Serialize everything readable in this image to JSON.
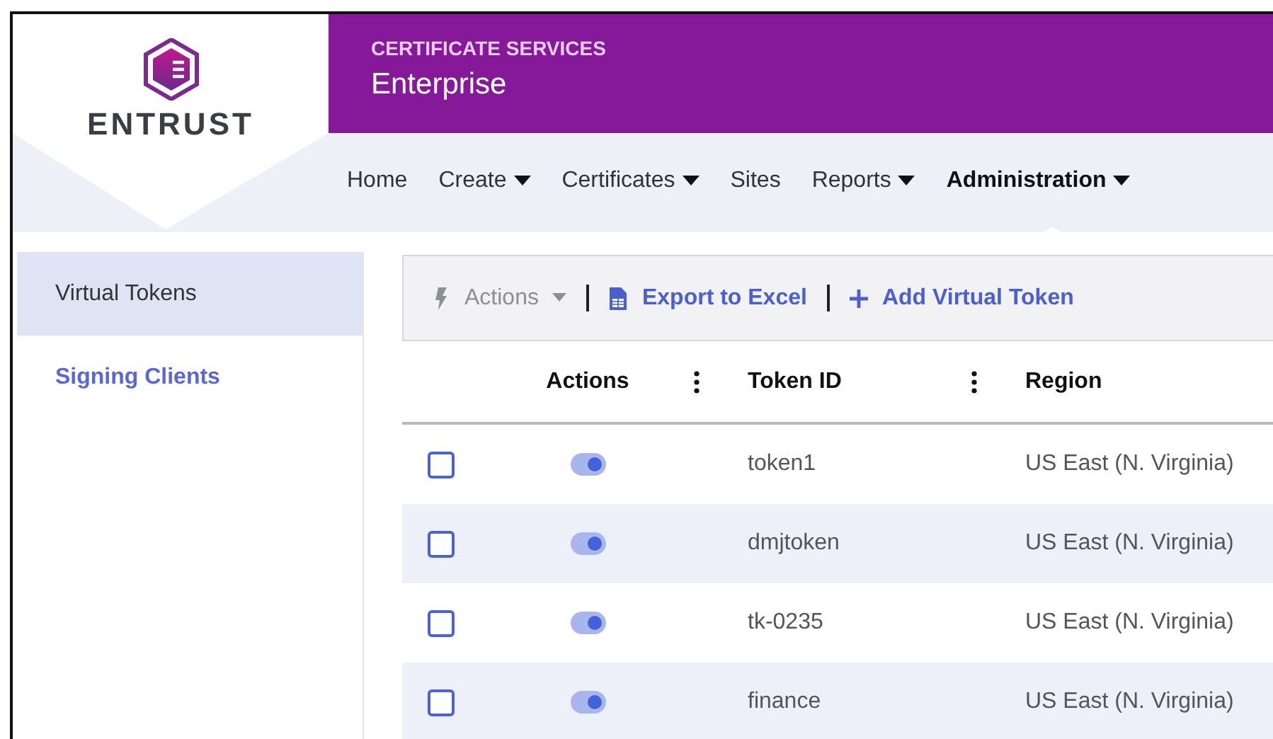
{
  "brand": {
    "logo_text": "ENTRUST",
    "product_line": "CERTIFICATE SERVICES",
    "product": "Enterprise"
  },
  "nav": [
    {
      "label": "Home",
      "dropdown": false,
      "selected": false
    },
    {
      "label": "Create",
      "dropdown": true,
      "selected": false
    },
    {
      "label": "Certificates",
      "dropdown": true,
      "selected": false
    },
    {
      "label": "Sites",
      "dropdown": false,
      "selected": false
    },
    {
      "label": "Reports",
      "dropdown": true,
      "selected": false
    },
    {
      "label": "Administration",
      "dropdown": true,
      "selected": true
    }
  ],
  "sidebar": {
    "items": [
      {
        "label": "Virtual Tokens",
        "selected": true
      },
      {
        "label": "Signing Clients",
        "selected": false
      }
    ]
  },
  "toolbar": [
    {
      "kind": "actions",
      "label": "Actions",
      "disabled": true
    },
    {
      "kind": "export",
      "label": "Export to Excel",
      "disabled": false
    },
    {
      "kind": "add",
      "label": "Add Virtual Token",
      "disabled": false
    }
  ],
  "table": {
    "columns": [
      "Actions",
      "Token ID",
      "Region"
    ],
    "rows": [
      {
        "checked": false,
        "on": true,
        "token_id": "token1",
        "region": "US East (N. Virginia)"
      },
      {
        "checked": false,
        "on": true,
        "token_id": "dmjtoken",
        "region": "US East (N. Virginia)"
      },
      {
        "checked": false,
        "on": true,
        "token_id": "tk-0235",
        "region": "US East (N. Virginia)"
      },
      {
        "checked": false,
        "on": true,
        "token_id": "finance",
        "region": "US East (N. Virginia)"
      }
    ]
  }
}
